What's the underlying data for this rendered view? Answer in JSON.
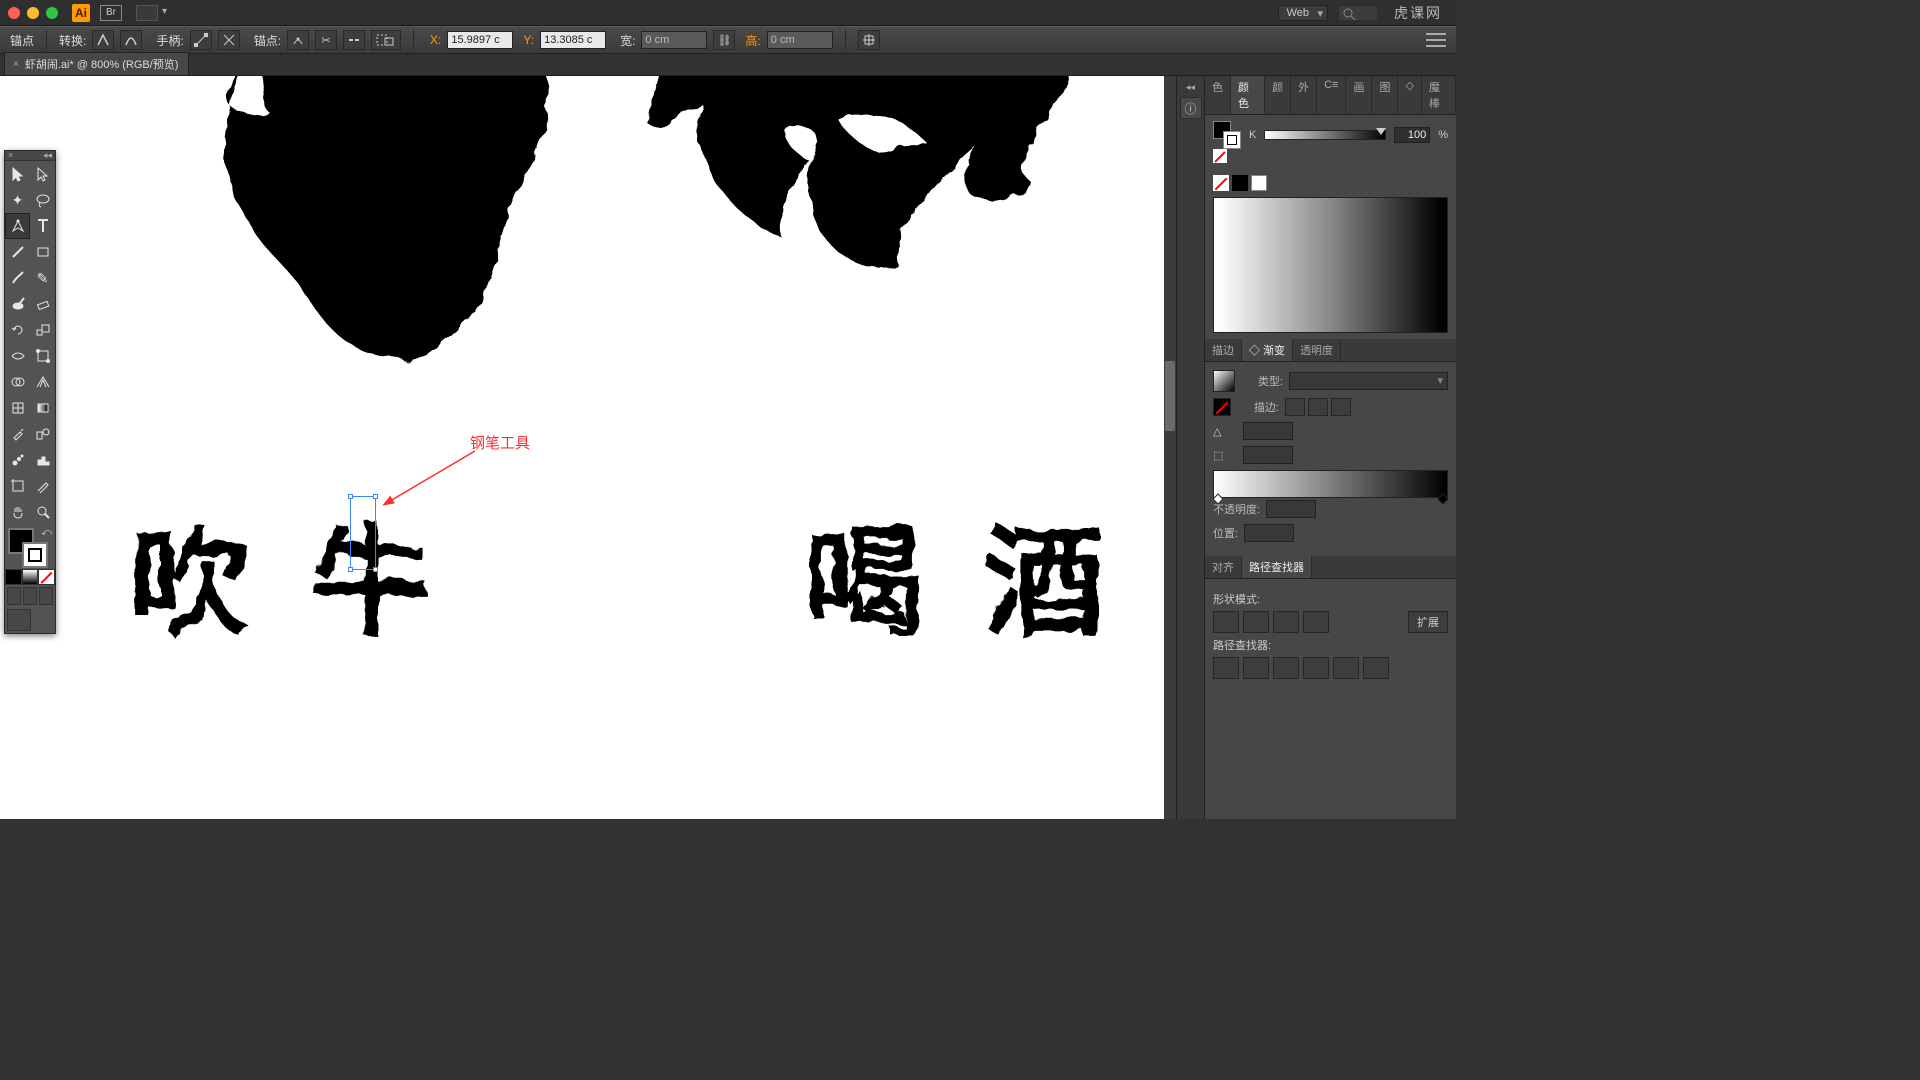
{
  "app": {
    "ai_badge": "Ai",
    "bridge_badge": "Br"
  },
  "topright": {
    "workspace": "Web",
    "watermark": "虎课网"
  },
  "controlbar": {
    "left_label": "锚点",
    "convert_label": "转换:",
    "handle_label": "手柄:",
    "anchor_label": "锚点:",
    "x_label": "X:",
    "x_value": "15.9897 c",
    "y_label": "Y:",
    "y_value": "13.3085 c",
    "w_label": "宽:",
    "w_value": "0 cm",
    "h_label": "高:",
    "h_value": "0 cm"
  },
  "tab": {
    "title": "虾胡闹.ai* @ 800% (RGB/预览)"
  },
  "annotation": {
    "label": "钢笔工具"
  },
  "canvas_text": {
    "c1": "吹",
    "c2": "牛",
    "c3": "喝",
    "c4": "酒"
  },
  "panels": {
    "color_tabs": [
      "色",
      "颜色",
      "颜",
      "外",
      "C≡",
      "画",
      "图",
      "◇",
      "魔棒"
    ],
    "k_label": "K",
    "k_value": "100",
    "k_pct": "%",
    "sgo_tabs": [
      "描边",
      "◇ 渐变",
      "透明度"
    ],
    "grad_type_label": "类型:",
    "grad_stroke_label": "描边:",
    "grad_opacity_label": "不透明度:",
    "grad_position_label": "位置:",
    "ap_tabs": [
      "对齐",
      "路径查找器"
    ],
    "shape_mode": "形状模式:",
    "expand": "扩展",
    "pathfinder": "路径查找器:"
  }
}
